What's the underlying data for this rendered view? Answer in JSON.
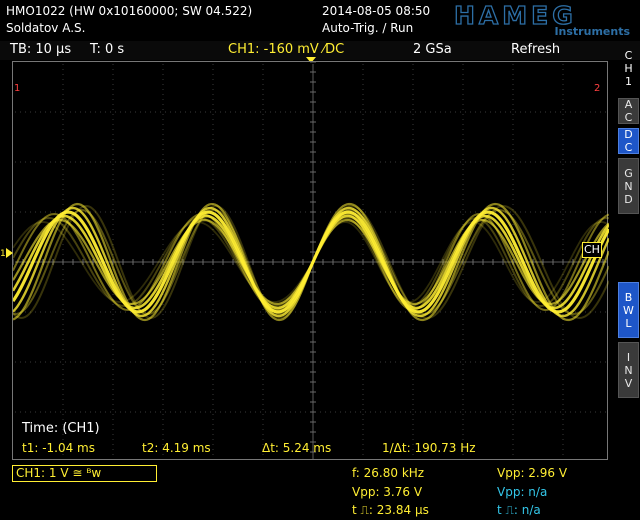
{
  "header": {
    "device_line": "HMO1022 (HW 0x10160000; SW 04.522)",
    "owner": "Soldatov A.S.",
    "datetime": "2014-08-05 08:50",
    "trigger_status": "Auto-Trig. / Run",
    "brand": "HAMEG",
    "brand_sub": "Instruments"
  },
  "top_bar": {
    "timebase": "TB: 10 µs",
    "time_offset": "T: 0 s",
    "channel_setting": "CH1: -160 mV ⁄DC",
    "sample_rate": "2 GSa",
    "acquire_mode": "Refresh"
  },
  "markers": {
    "left_top": "1",
    "right_top": "2",
    "left_ch": "1",
    "right_ch": "CH"
  },
  "cursor_readout": {
    "title": "Time: (CH1)",
    "t1": "t1: -1.04 ms",
    "t2": "t2: 4.19 ms",
    "dt": "Δt: 5.24 ms",
    "inv_dt": "1/Δt: 190.73 Hz"
  },
  "side_panel": {
    "title": [
      "C",
      "H",
      "1"
    ],
    "buttons": [
      {
        "label": [
          "A",
          "C"
        ],
        "active": false
      },
      {
        "label": [
          "D",
          "C"
        ],
        "active": true
      },
      {
        "label": [
          "G",
          "N",
          "D"
        ],
        "active": false
      },
      {
        "label": [
          "B",
          "W",
          "L"
        ],
        "active": true
      },
      {
        "label": [
          "I",
          "N",
          "V"
        ],
        "active": false
      }
    ]
  },
  "bottom": {
    "ch1_scale": "CH1: 1 V ≅ ᴮᴡ",
    "frequency": "f: 26.80 kHz",
    "vpp_ch1": "Vpp: 3.76 V",
    "pulse_width_ch1": "t ⎍: 23.84 µs",
    "vpp_ch1_2": "Vpp: 2.96 V",
    "vpp_ch2": "Vpp: n/a",
    "pulse_width_ch2": "t ⎍: n/a"
  },
  "colors": {
    "channel1": "#ffee33",
    "channel2": "#33c6e8",
    "active_button": "#1e56c8",
    "marker": "#ff4040",
    "brand": "#2d6fa6"
  }
}
